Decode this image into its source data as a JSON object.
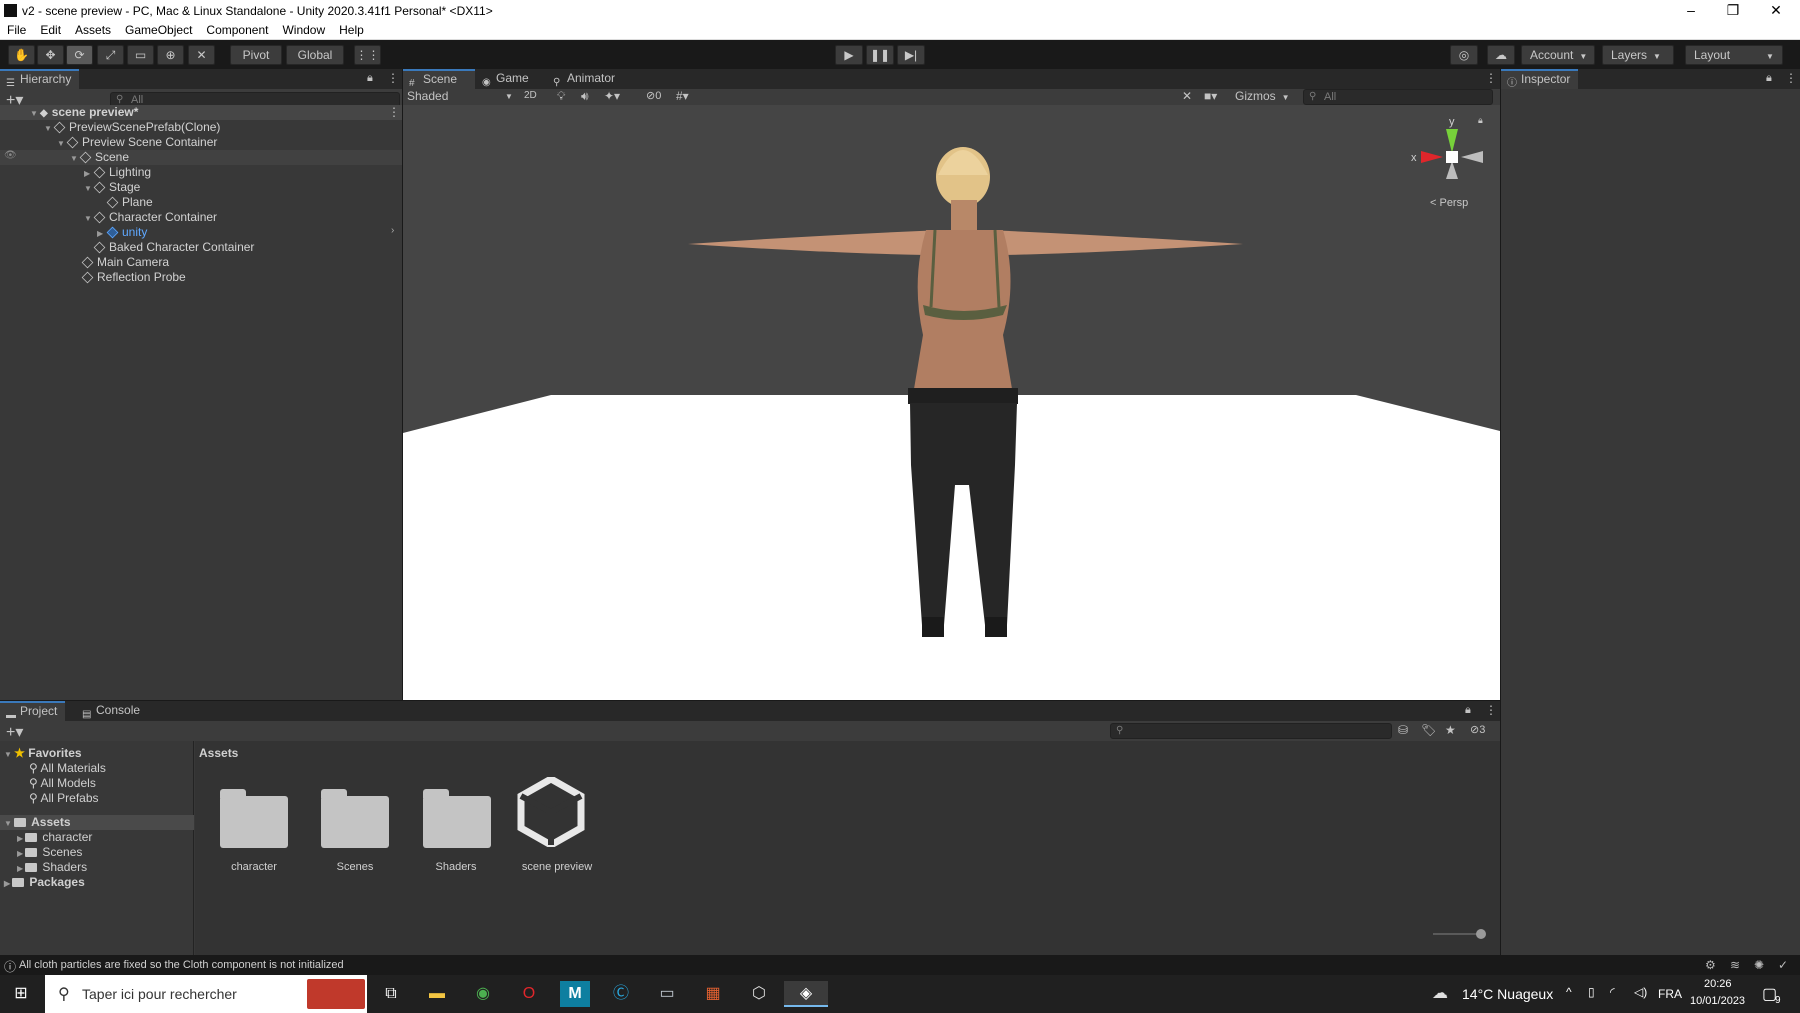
{
  "window": {
    "title": "v2 - scene preview - PC, Mac & Linux Standalone - Unity 2020.3.41f1 Personal* <DX11>",
    "minimize": "–",
    "maximize": "❐",
    "close": "✕"
  },
  "menu": [
    "File",
    "Edit",
    "Assets",
    "GameObject",
    "Component",
    "Window",
    "Help"
  ],
  "toolbar": {
    "pivot": "Pivot",
    "global": "Global",
    "account": "Account",
    "layers": "Layers",
    "layout": "Layout"
  },
  "hierarchy": {
    "tab": "Hierarchy",
    "search_placeholder": "All",
    "scene_name": "scene preview*",
    "items": [
      "PreviewScenePrefab(Clone)",
      "Preview Scene Container",
      "Scene",
      "Lighting",
      "Stage",
      "Plane",
      "Character Container",
      "unity",
      "Baked Character Container",
      "Main Camera",
      "Reflection Probe"
    ]
  },
  "scene": {
    "tabs": [
      "Scene",
      "Game",
      "Animator"
    ],
    "draw_mode": "Shaded",
    "btn_2d": "2D",
    "hidden_count": "0",
    "gizmos": "Gizmos",
    "search_placeholder": "All",
    "axis_y": "y",
    "axis_x": "x",
    "persp": "< Persp"
  },
  "inspector": {
    "tab": "Inspector"
  },
  "project": {
    "tabs": [
      "Project",
      "Console"
    ],
    "favorites": "Favorites",
    "favorite_items": [
      "All Materials",
      "All Models",
      "All Prefabs"
    ],
    "assets_root": "Assets",
    "asset_folders": [
      "character",
      "Scenes",
      "Shaders"
    ],
    "packages": "Packages",
    "breadcrumb": "Assets",
    "grid_items": [
      "character",
      "Scenes",
      "Shaders",
      "scene preview"
    ],
    "hidden_count": "3"
  },
  "status": {
    "message": "All cloth particles are fixed so the Cloth component is not initialized"
  },
  "taskbar": {
    "search_placeholder": "Taper ici pour rechercher",
    "weather": "14°C  Nuageux",
    "lang": "FRA",
    "time": "20:26",
    "date": "10/01/2023",
    "notif_count": "9"
  },
  "colors": {
    "accent": "#3a79bb",
    "panel": "#383838",
    "scene_bg": "#454545",
    "floor": "#ffffff"
  }
}
